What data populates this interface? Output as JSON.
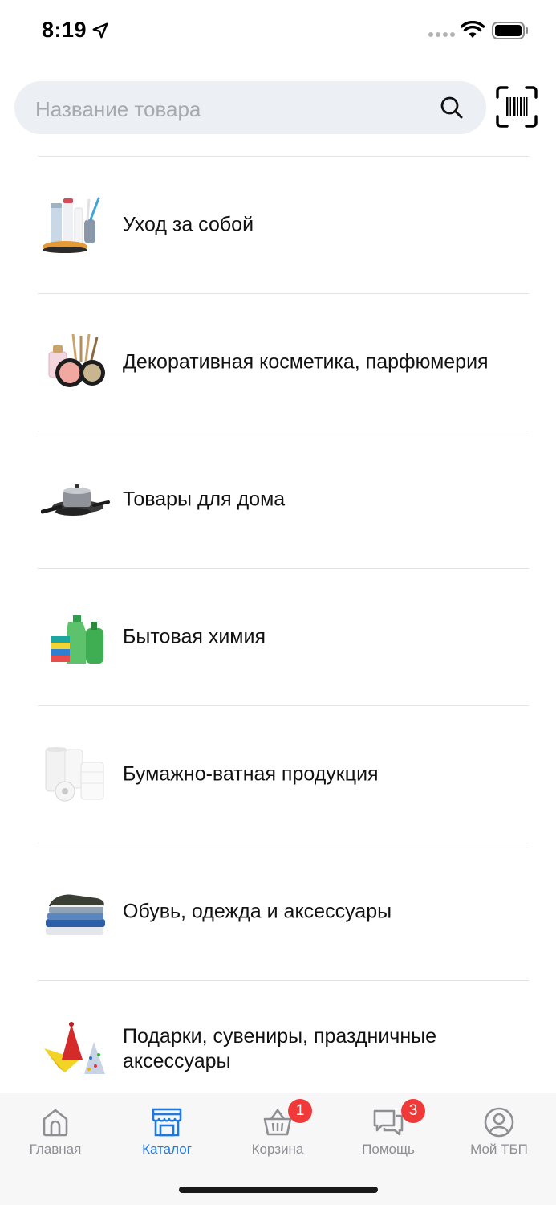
{
  "status_bar": {
    "time": "8:19"
  },
  "search": {
    "placeholder": "Название товара",
    "search_icon": "search-icon",
    "scan_icon": "barcode-scan-icon"
  },
  "categories": [
    {
      "label": "Уход за собой",
      "icon": "personal-care-image"
    },
    {
      "label": "Декоративная косметика, парфюмерия",
      "icon": "cosmetics-image"
    },
    {
      "label": "Товары для дома",
      "icon": "cookware-image"
    },
    {
      "label": "Бытовая химия",
      "icon": "household-chemicals-image"
    },
    {
      "label": "Бумажно-ватная продукция",
      "icon": "paper-products-image"
    },
    {
      "label": "Обувь, одежда и аксессуары",
      "icon": "clothing-image"
    },
    {
      "label": "Подарки, сувениры, праздничные аксессуары",
      "icon": "party-hats-image"
    }
  ],
  "tab_bar": {
    "active_color": "#1f7ae0",
    "inactive_color": "#8e8e93",
    "badge_color": "#f03a3a",
    "tabs": [
      {
        "label": "Главная",
        "icon": "home-icon"
      },
      {
        "label": "Каталог",
        "icon": "store-icon",
        "active": true
      },
      {
        "label": "Корзина",
        "icon": "basket-icon",
        "badge": "1"
      },
      {
        "label": "Помощь",
        "icon": "chat-icon",
        "badge": "3"
      },
      {
        "label": "Мой ТБП",
        "icon": "profile-icon"
      }
    ]
  }
}
